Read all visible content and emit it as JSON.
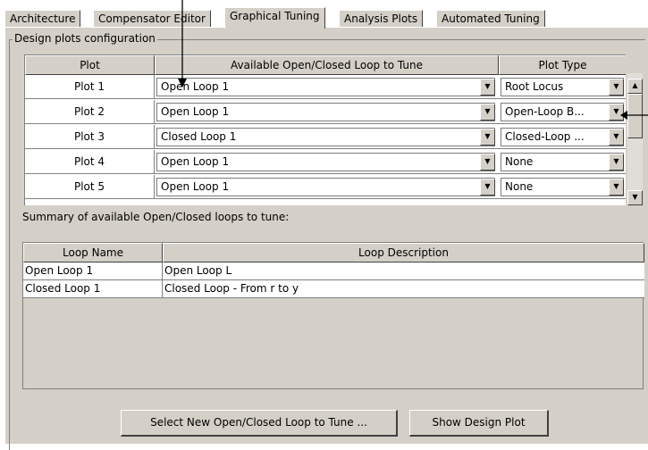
{
  "tabs": [
    {
      "label": "Architecture"
    },
    {
      "label": "Compensator Editor"
    },
    {
      "label": "Graphical Tuning"
    },
    {
      "label": "Analysis Plots"
    },
    {
      "label": "Automated Tuning"
    }
  ],
  "design_group": {
    "title": "Design plots configuration"
  },
  "plots_table": {
    "headers": [
      "Plot",
      "Available Open/Closed Loop to Tune",
      "Plot Type"
    ],
    "rows": [
      {
        "plot": "Plot 1",
        "loop": "Open Loop 1",
        "type": "Root Locus"
      },
      {
        "plot": "Plot 2",
        "loop": "Open Loop 1",
        "type": "Open-Loop B..."
      },
      {
        "plot": "Plot 3",
        "loop": "Closed Loop 1",
        "type": "Closed-Loop ..."
      },
      {
        "plot": "Plot 4",
        "loop": "Open Loop 1",
        "type": "None"
      },
      {
        "plot": "Plot 5",
        "loop": "Open Loop 1",
        "type": "None"
      }
    ]
  },
  "summary": {
    "label": "Summary of available Open/Closed loops to tune:",
    "headers": [
      "Loop Name",
      "Loop Description"
    ],
    "rows": [
      {
        "name": "Open Loop 1",
        "description": "Open Loop L"
      },
      {
        "name": "Closed Loop 1",
        "description": "Closed Loop - From r to y"
      }
    ]
  },
  "buttons": {
    "select_new": "Select New Open/Closed Loop to Tune ...",
    "show_design": "Show Design Plot"
  }
}
